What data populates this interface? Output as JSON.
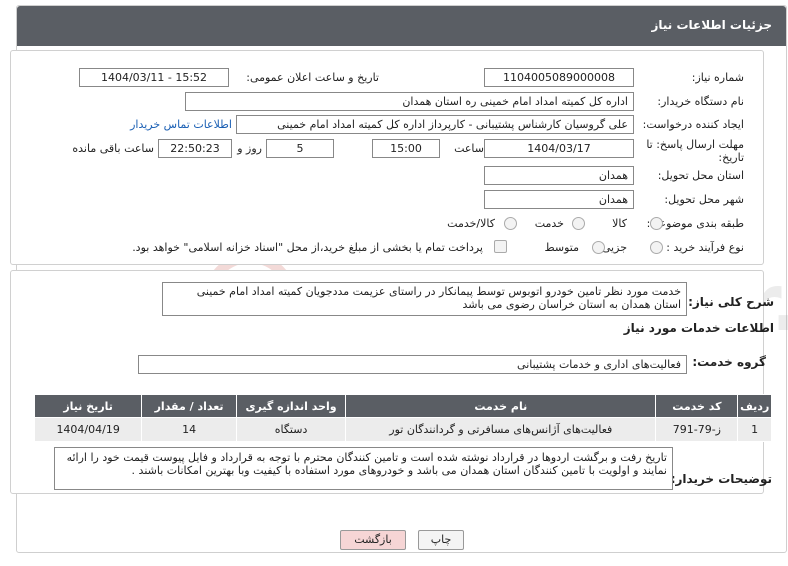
{
  "header": {
    "title": "جزئیات اطلاعات نیاز"
  },
  "form": {
    "need_number_label": "شماره نیاز:",
    "need_number": "1104005089000008",
    "announce_label": "تاریخ و ساعت اعلان عمومی:",
    "announce_value": "1404/03/11 - 15:52",
    "buyer_org_label": "نام دستگاه خریدار:",
    "buyer_org": "اداره کل کمیته امداد امام خمینی  ره   استان همدان",
    "creator_label": "ایجاد کننده درخواست:",
    "creator": "علی گروسیان کارشناس پشتیبانی - کارپرداز  اداره کل کمیته امداد امام خمینی",
    "contact_link": "اطلاعات تماس خریدار",
    "deadline_label_1": "مهلت ارسال پاسخ: تا",
    "deadline_label_2": "تاریخ:",
    "deadline_date": "1404/03/17",
    "time_label": "ساعت",
    "deadline_time": "15:00",
    "days": "5",
    "days_label": "روز و",
    "remaining": "22:50:23",
    "remaining_label": "ساعت باقی مانده",
    "delivery_province_label": "استان محل تحویل:",
    "delivery_province": "همدان",
    "delivery_city_label": "شهر محل تحویل:",
    "delivery_city": "همدان",
    "category_label": "طبقه بندی موضوعی:",
    "category_options": [
      "کالا",
      "خدمت",
      "کالا/خدمت"
    ],
    "process_label": "نوع فرآیند خرید :",
    "process_options": [
      "جزیی",
      "متوسط"
    ],
    "payment_note": "پرداخت تمام یا بخشی از مبلغ خرید،از محل \"اسناد خزانه اسلامی\" خواهد بود."
  },
  "details": {
    "summary_label": "شرح کلی نیاز:",
    "summary": "خدمت مورد نظر تامین خودرو اتوبوس توسط پیمانکار در راستای عزیمت مددجویان کمیته امداد امام خمینی استان همدان به استان خراسان رضوی می باشد",
    "services_title": "اطلاعات خدمات مورد نیاز",
    "service_group_label": "گروه خدمت:",
    "service_group": "فعالیت‌های اداری و خدمات پشتیبانی",
    "table": {
      "headers": [
        "ردیف",
        "کد خدمت",
        "نام خدمت",
        "واحد اندازه گیری",
        "تعداد / مقدار",
        "تاریخ نیاز"
      ],
      "rows": [
        [
          "1",
          "ز-79-791",
          "فعالیت‌های آژانس‌های مسافرتی و گردانندگان تور",
          "دستگاه",
          "14",
          "1404/04/19"
        ]
      ]
    },
    "buyer_notes_label": "توضیحات خریدار:",
    "buyer_notes": "تاریخ رفت و برگشت اردوها در قرارداد نوشته شده است و تامین کنندگان محترم با توجه به قرارداد و فایل پیوست قیمت خود را ارائه نمایند و اولویت با تامین کنندگان استان همدان می باشد و خودروهای مورد استفاده با کیفیت وبا بهترین امکانات باشند ."
  },
  "buttons": {
    "print": "چاپ",
    "back": "بازگشت"
  },
  "watermark": {
    "text": "AriaTender.neT"
  },
  "colors": {
    "header_bg": "#5a5e64",
    "link": "#1a5fb4",
    "back_btn_bg": "#f6d5d5"
  }
}
